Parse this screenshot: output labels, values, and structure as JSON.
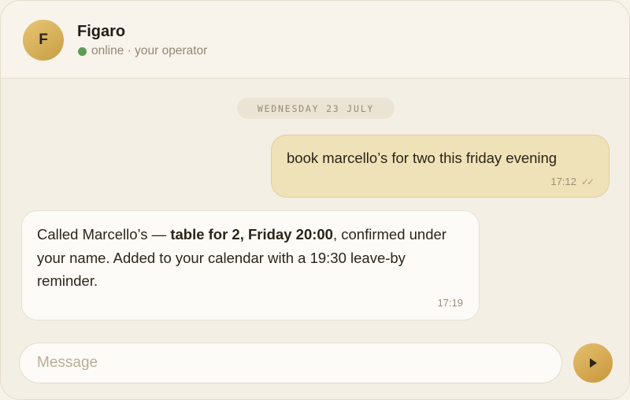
{
  "contact": {
    "avatar_initial": "F",
    "name": "Figaro",
    "status": "online · your operator",
    "status_color": "#5e9b57"
  },
  "date_divider": "WEDNESDAY 23 JULY",
  "messages": [
    {
      "direction": "outgoing",
      "text": "book marcello’s for two this friday evening",
      "time": "17:12",
      "receipt_icon": "double-check-icon"
    },
    {
      "direction": "incoming",
      "text_before": "Called Marcello’s — ",
      "text_bold": "table for 2, Friday 20:00",
      "text_after": ", confirmed under your name. Added to your calendar with a 19:30 leave-by reminder.",
      "time": "17:19"
    }
  ],
  "composer": {
    "placeholder": "Message",
    "value": ""
  },
  "send_button": {
    "icon": "play-icon"
  },
  "colors": {
    "accent_gold": "#c99d43",
    "outgoing_bubble": "#efe2b8",
    "incoming_bubble": "#fdfbf7",
    "background": "#f4efe4"
  }
}
